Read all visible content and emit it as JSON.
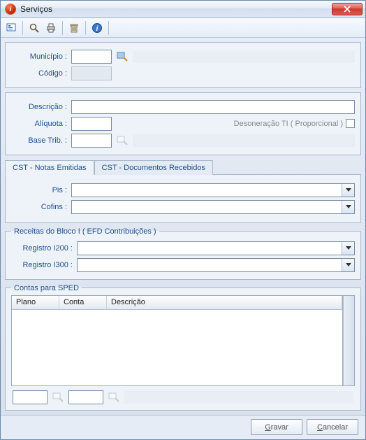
{
  "window": {
    "title": "Serviços"
  },
  "toolbar": {
    "icons": [
      "filter-icon",
      "search-icon",
      "print-icon",
      "delete-icon",
      "help-icon"
    ]
  },
  "group1": {
    "municipio_label": "Município :",
    "codigo_label": "Código :",
    "municipio_value": "",
    "municipio_desc": "",
    "codigo_value": ""
  },
  "group2": {
    "descricao_label": "Descrição :",
    "aliquota_label": "Alíquota :",
    "base_label": "Base Trib. :",
    "descricao_value": "",
    "aliquota_value": "",
    "base_value": "",
    "base_desc": "",
    "desoneracao_label": "Desoneração TI ( Proporcional )"
  },
  "tabs": {
    "tab1": "CST - Notas Emitidas",
    "tab2": "CST - Documentos Recebidos",
    "pis_label": "Pis :",
    "cofins_label": "Cofins :",
    "pis_value": "",
    "cofins_value": ""
  },
  "bloco": {
    "legend": "Receitas do Bloco I ( EFD Contribuições )",
    "i200_label": "Registro I200 :",
    "i300_label": "Registro I300 :",
    "i200_value": "",
    "i300_value": ""
  },
  "sped": {
    "legend": "Contas para SPED",
    "col_plano": "Plano",
    "col_conta": "Conta",
    "col_descricao": "Descrição",
    "bottom_val1": "",
    "bottom_val2": "",
    "bottom_desc": ""
  },
  "footer": {
    "gravar": "Gravar",
    "cancelar": "Cancelar"
  }
}
